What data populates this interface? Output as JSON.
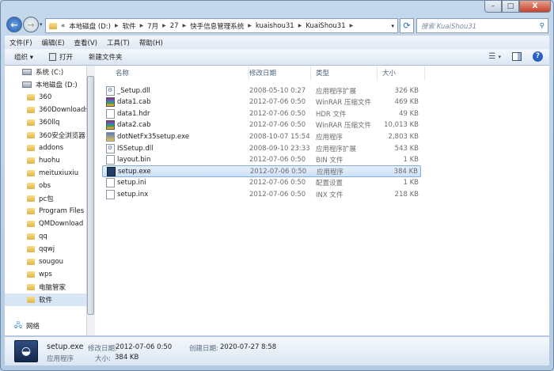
{
  "window": {
    "minimize": "–",
    "maximize": "□",
    "close": "X"
  },
  "address": {
    "overflow": "«",
    "segments": [
      "本地磁盘 (D:)",
      "软件",
      "7月",
      "27",
      "快手信息管理系统",
      "kuaishou31",
      "KuaiShou31"
    ]
  },
  "search": {
    "placeholder": "搜索 KuaiShou31"
  },
  "menu": [
    "文件(F)",
    "编辑(E)",
    "查看(V)",
    "工具(T)",
    "帮助(H)"
  ],
  "toolbar": {
    "organize": "组织 ▾",
    "open": "打开",
    "new_folder": "新建文件夹"
  },
  "sidebar": {
    "items": [
      {
        "label": "系统 (C:)",
        "type": "drive"
      },
      {
        "label": "本地磁盘 (D:)",
        "type": "drive"
      },
      {
        "label": "360",
        "type": "folder"
      },
      {
        "label": "360Downloads",
        "type": "folder"
      },
      {
        "label": "360llq",
        "type": "folder"
      },
      {
        "label": "360安全浏览器",
        "type": "folder"
      },
      {
        "label": "addons",
        "type": "folder"
      },
      {
        "label": "huohu",
        "type": "folder"
      },
      {
        "label": "meituxiuxiu",
        "type": "folder"
      },
      {
        "label": "obs",
        "type": "folder"
      },
      {
        "label": "pc包",
        "type": "folder"
      },
      {
        "label": "Program Files",
        "type": "folder"
      },
      {
        "label": "QMDownload",
        "type": "folder"
      },
      {
        "label": "qq",
        "type": "folder"
      },
      {
        "label": "qqwj",
        "type": "folder"
      },
      {
        "label": "sougou",
        "type": "folder"
      },
      {
        "label": "wps",
        "type": "folder"
      },
      {
        "label": "电脑管家",
        "type": "folder"
      },
      {
        "label": "软件",
        "type": "folder",
        "selected": true
      }
    ],
    "network": "网络"
  },
  "columns": {
    "name": "名称",
    "date": "修改日期",
    "type": "类型",
    "size": "大小"
  },
  "files": [
    {
      "name": "_Setup.dll",
      "date": "2008-05-10 0:27",
      "type": "应用程序扩展",
      "size": "326 KB",
      "icon": "dll"
    },
    {
      "name": "data1.cab",
      "date": "2012-07-06 0:50",
      "type": "WinRAR 压缩文件",
      "size": "469 KB",
      "icon": "rar"
    },
    {
      "name": "data1.hdr",
      "date": "2012-07-06 0:50",
      "type": "HDR 文件",
      "size": "49 KB",
      "icon": "file"
    },
    {
      "name": "data2.cab",
      "date": "2012-07-06 0:50",
      "type": "WinRAR 压缩文件",
      "size": "10,013 KB",
      "icon": "rar"
    },
    {
      "name": "dotNetFx35setup.exe",
      "date": "2008-10-07 15:54",
      "type": "应用程序",
      "size": "2,803 KB",
      "icon": "net"
    },
    {
      "name": "ISSetup.dll",
      "date": "2008-09-10 23:33",
      "type": "应用程序扩展",
      "size": "543 KB",
      "icon": "dll"
    },
    {
      "name": "layout.bin",
      "date": "2012-07-06 0:50",
      "type": "BIN 文件",
      "size": "1 KB",
      "icon": "file"
    },
    {
      "name": "setup.exe",
      "date": "2012-07-06 0:50",
      "type": "应用程序",
      "size": "384 KB",
      "icon": "exe",
      "selected": true
    },
    {
      "name": "setup.ini",
      "date": "2012-07-06 0:50",
      "type": "配置设置",
      "size": "1 KB",
      "icon": "file"
    },
    {
      "name": "setup.inx",
      "date": "2012-07-06 0:50",
      "type": "INX 文件",
      "size": "218 KB",
      "icon": "file"
    }
  ],
  "status": {
    "name": "setup.exe",
    "modified_label": "修改日期:",
    "modified": "2012-07-06 0:50",
    "created_label": "创建日期:",
    "created": "2020-07-27 8:58",
    "type": "应用程序",
    "size_label": "大小:",
    "size": "384 KB"
  }
}
